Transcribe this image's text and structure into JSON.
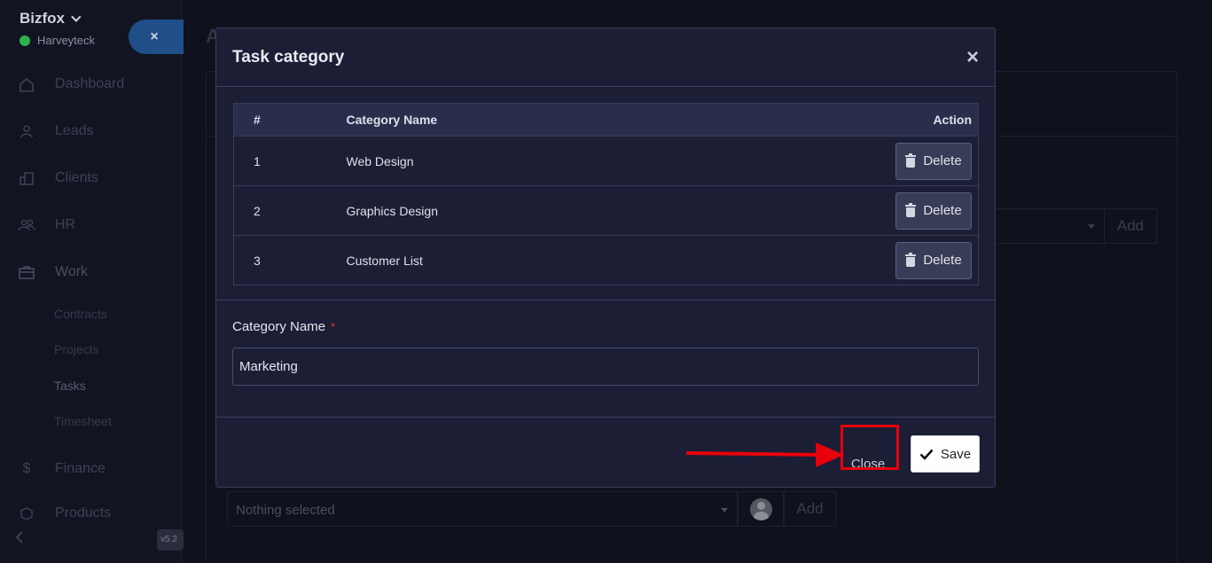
{
  "sidebar": {
    "brand": "Bizfox",
    "company": "Harveyteck",
    "toggle_icon": "×",
    "items": [
      {
        "label": "Dashboard",
        "icon": "home-icon"
      },
      {
        "label": "Leads",
        "icon": "user-icon"
      },
      {
        "label": "Clients",
        "icon": "building-icon"
      },
      {
        "label": "HR",
        "icon": "users-icon"
      },
      {
        "label": "Work",
        "icon": "briefcase-icon"
      },
      {
        "label": "Finance",
        "icon": "dollar-icon"
      },
      {
        "label": "Products",
        "icon": "box-icon"
      }
    ],
    "work_sub": [
      "Contracts",
      "Projects",
      "Tasks",
      "Timesheet"
    ],
    "version": "v5.2"
  },
  "background": {
    "title": "A",
    "add_label": "Add",
    "nothing_selected": "Nothing selected",
    "add_label_bottom": "Add"
  },
  "modal": {
    "title": "Task category",
    "close_x": "×",
    "table": {
      "headers": [
        "#",
        "Category Name",
        "Action"
      ],
      "rows": [
        {
          "num": "1",
          "name": "Web Design",
          "action": "Delete"
        },
        {
          "num": "2",
          "name": "Graphics Design",
          "action": "Delete"
        },
        {
          "num": "3",
          "name": "Customer List",
          "action": "Delete"
        }
      ]
    },
    "field": {
      "label": "Category Name",
      "required_mark": "*",
      "value": "Marketing"
    },
    "footer": {
      "close_label": "Close",
      "save_label": "Save"
    }
  },
  "colors": {
    "accent_highlight": "#e8000b",
    "modal_bg": "#1b1e35",
    "status_online": "#2bb24c"
  }
}
